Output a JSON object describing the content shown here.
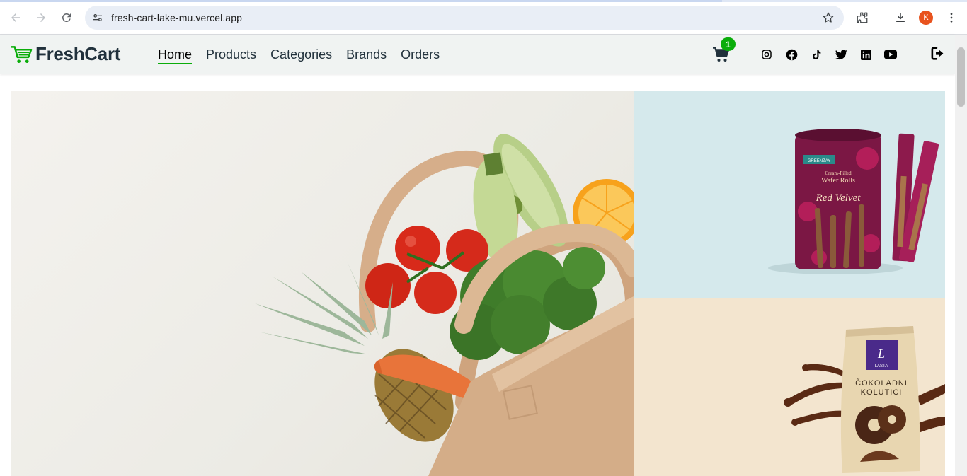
{
  "browser": {
    "url": "fresh-cart-lake-mu.vercel.app",
    "profile_initial": "K",
    "icons": [
      "back-icon",
      "forward-icon",
      "reload-icon",
      "site-info-icon",
      "star-icon",
      "extensions-icon",
      "download-icon",
      "menu-dots-icon"
    ]
  },
  "navbar": {
    "brand": "FreshCart",
    "links": [
      {
        "label": "Home",
        "active": true
      },
      {
        "label": "Products",
        "active": false
      },
      {
        "label": "Categories",
        "active": false
      },
      {
        "label": "Brands",
        "active": false
      },
      {
        "label": "Orders",
        "active": false
      }
    ],
    "cart_count": "1",
    "socials": [
      "instagram-icon",
      "facebook-icon",
      "tiktok-icon",
      "twitter-icon",
      "linkedin-icon",
      "youtube-icon"
    ],
    "logout_icon": "logout-icon"
  },
  "hero": {
    "main_image": "grocery-bag-vegetables",
    "side_top_image": "red-velvet-wafer-rolls",
    "side_top_text": [
      "GREENZAY",
      "Cream-Filled",
      "Wafer Rolls",
      "Red Velvet"
    ],
    "side_bottom_image": "chocolate-cookies-bag",
    "side_bottom_text": [
      "LASTA",
      "ČOKOLADNI",
      "KOLUTIĆI"
    ]
  },
  "colors": {
    "accent": "#0aad0a",
    "navbar_bg": "#f0f3f2",
    "text": "#21313c"
  }
}
